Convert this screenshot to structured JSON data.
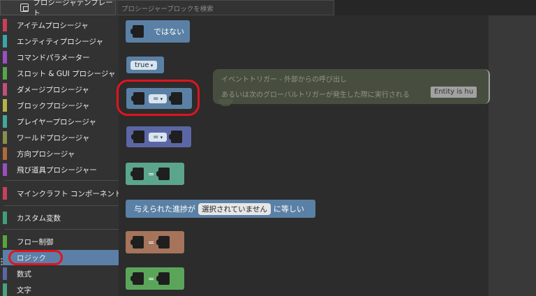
{
  "topbar": {
    "template_label": "プロシージャテンプレート",
    "search_placeholder": "プロシージャーブロックを検索"
  },
  "sidebar": {
    "items": [
      {
        "label": "アイテムプロシージャ",
        "color": "#c8405a"
      },
      {
        "label": "エンティティプロシージャ",
        "color": "#3aa5a8"
      },
      {
        "label": "コマンドパラメーター",
        "color": "#9b4fbf"
      },
      {
        "label": "スロット & GUI プロシージャ",
        "color": "#58a648"
      },
      {
        "label": "ダメージプロシージャ",
        "color": "#c0507e"
      },
      {
        "label": "ブロックプロシージャ",
        "color": "#b6b24a"
      },
      {
        "label": "プレイヤープロシージャ",
        "color": "#43a79c"
      },
      {
        "label": "ワールドプロシージャ",
        "color": "#8a8f4a"
      },
      {
        "label": "方向プロシージャ",
        "color": "#b06a3a"
      },
      {
        "label": "飛び道具プロシージャー",
        "color": "#9b4fbf"
      },
      {
        "label": "マインクラフト コンポーネント",
        "color": "#c8405a"
      },
      {
        "label": "カスタム変数",
        "color": "#3fa078"
      },
      {
        "label": "フロー制御",
        "color": "#57a63e"
      },
      {
        "label": "ロジック",
        "color": "#5b80a5"
      },
      {
        "label": "数式",
        "color": "#5b67a5"
      },
      {
        "label": "文字",
        "color": "#4aa17e"
      }
    ]
  },
  "blocks": {
    "not_label": "ではない",
    "true_label": "true",
    "eq_label": "=",
    "advancement_prefix": "与えられた進捗が",
    "advancement_value": "選択されていません",
    "advancement_suffix": "に等しい"
  },
  "ghost": {
    "line1": "イベントトリガー - 外部からの呼び出し",
    "line2": "あるいは次のグローバルトリガーが発生した際に実行される",
    "entity_chip": "Entity is hu"
  },
  "colors": {
    "logic_block": "#5b80a5",
    "teal_block": "#5ba58c",
    "brown_block": "#a5745b",
    "green_block": "#5ba55b",
    "highlight": "#e0141e"
  }
}
